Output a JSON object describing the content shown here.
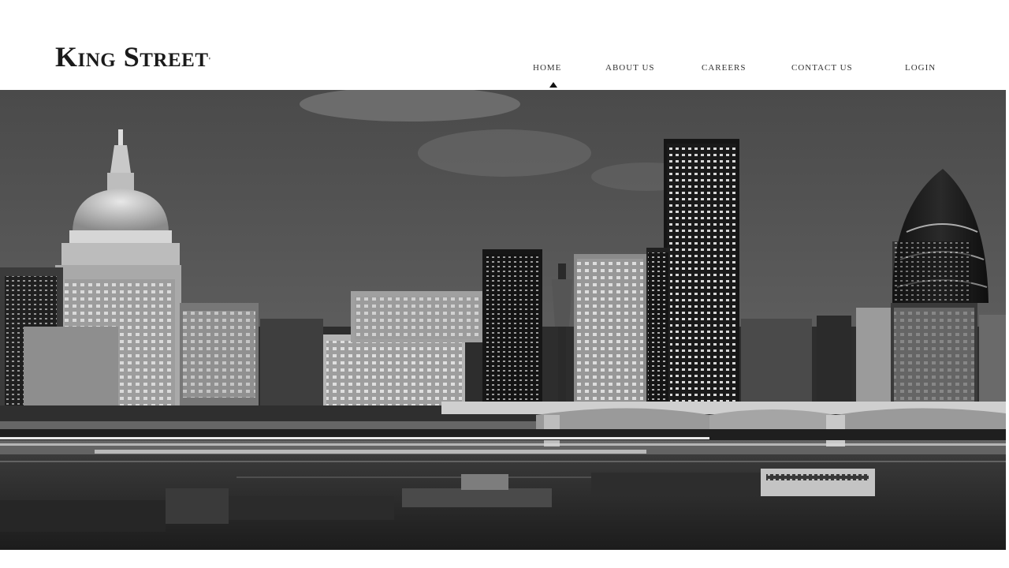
{
  "brand": {
    "name": "King Street",
    "mark": "'"
  },
  "nav": {
    "items": [
      {
        "label": "Home",
        "active": true
      },
      {
        "label": "About Us",
        "active": false
      },
      {
        "label": "Careers",
        "active": false
      },
      {
        "label": "Contact Us",
        "active": false
      },
      {
        "label": "Login",
        "active": false
      }
    ]
  },
  "hero": {
    "image": "london-skyline-night-bw",
    "style": "black-and-white"
  },
  "colors": {
    "header_bg": "#ffffff",
    "text": "#1a1a1a",
    "nav_text": "#333333"
  }
}
